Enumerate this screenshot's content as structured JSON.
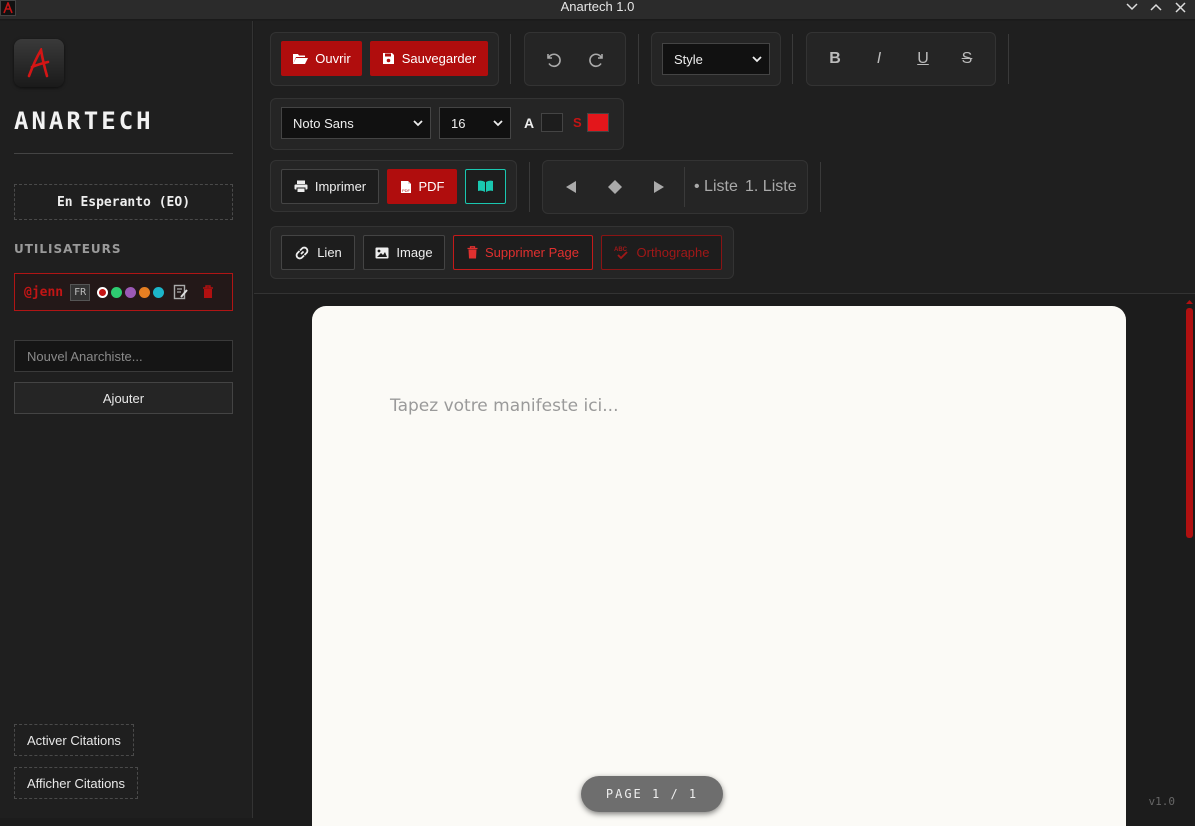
{
  "window": {
    "title": "Anartech 1.0"
  },
  "sidebar": {
    "brand": "ANARTECH",
    "language_button": "En Esperanto (EO)",
    "users_heading": "UTILISATEURS",
    "users": [
      {
        "name": "@jenn",
        "lang": "FR",
        "colors": [
          "#c41414",
          "#2ecc71",
          "#9b59b6",
          "#e67e22",
          "#1cb5c9"
        ]
      }
    ],
    "new_user_placeholder": "Nouvel Anarchiste...",
    "add_button": "Ajouter",
    "enable_quotes": "Activer Citations",
    "show_quotes": "Afficher Citations"
  },
  "toolbar": {
    "open": "Ouvrir",
    "save": "Sauvegarder",
    "style_select": "Style",
    "bold": "B",
    "italic": "I",
    "underline": "U",
    "strike": "S",
    "font_family": "Noto Sans",
    "font_size": "16",
    "text_color_label": "A",
    "highlight_label": "S",
    "text_color": "#1d1d1d",
    "highlight_color": "#e3161b",
    "print": "Imprimer",
    "pdf": "PDF",
    "bullet_list": "• Liste",
    "numbered_list": "1. Liste",
    "link": "Lien",
    "image": "Image",
    "delete_page": "Supprimer Page",
    "spelling": "Orthographe"
  },
  "editor": {
    "placeholder": "Tapez votre manifeste ici...",
    "page_indicator": "PAGE 1 / 1",
    "version": "v1.0"
  },
  "colors": {
    "accent": "#b00d0d",
    "teal": "#1ac7b0",
    "background": "#1c1c1c",
    "page": "#fbfaf6"
  }
}
